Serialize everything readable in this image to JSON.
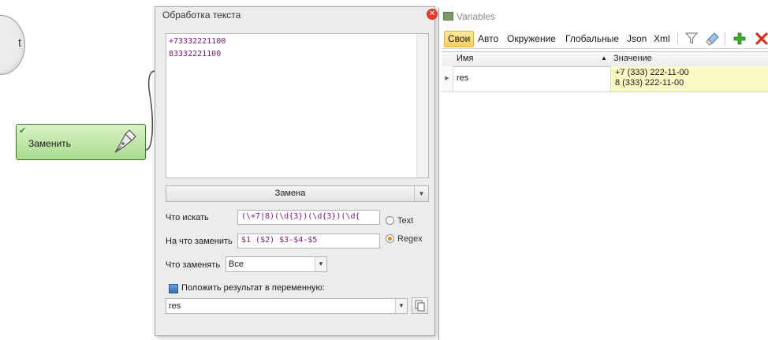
{
  "canvas": {
    "start_node_label": "t",
    "replace_node_label": "Заменить"
  },
  "dialog": {
    "title": "Обработка текста",
    "text_lines": [
      "+73332221100",
      "83332221100"
    ],
    "mode": "Замена",
    "find_label": "Что искать",
    "find_value": "(\\+7|8)(\\d{3})(\\d{3})(\\d{",
    "replace_label": "На что заменить",
    "replace_value": "$1 ($2) $3-$4-$5",
    "radio_text": "Text",
    "radio_regex": "Regex",
    "selected_radio": "Regex",
    "which_label": "Что заменять",
    "which_value": "Все",
    "save_label": "Положить результат в переменную:",
    "save_var": "res"
  },
  "variables": {
    "title": "Variables",
    "tabs": [
      "Свои",
      "Авто",
      "Окружение",
      "Глобальные",
      "Json",
      "Xml"
    ],
    "active_tab": "Свои",
    "columns": {
      "name": "Имя",
      "value": "Значение"
    },
    "rows": [
      {
        "name": "res",
        "value_lines": [
          "+7 (333) 222-11-00",
          "8 (333) 222-11-00"
        ]
      }
    ]
  },
  "colors": {
    "accent_tab": "#fbd05a",
    "node_green": "#a9db8d",
    "value_cell": "#fdf9c4",
    "regex_text": "#7a1a7a"
  }
}
